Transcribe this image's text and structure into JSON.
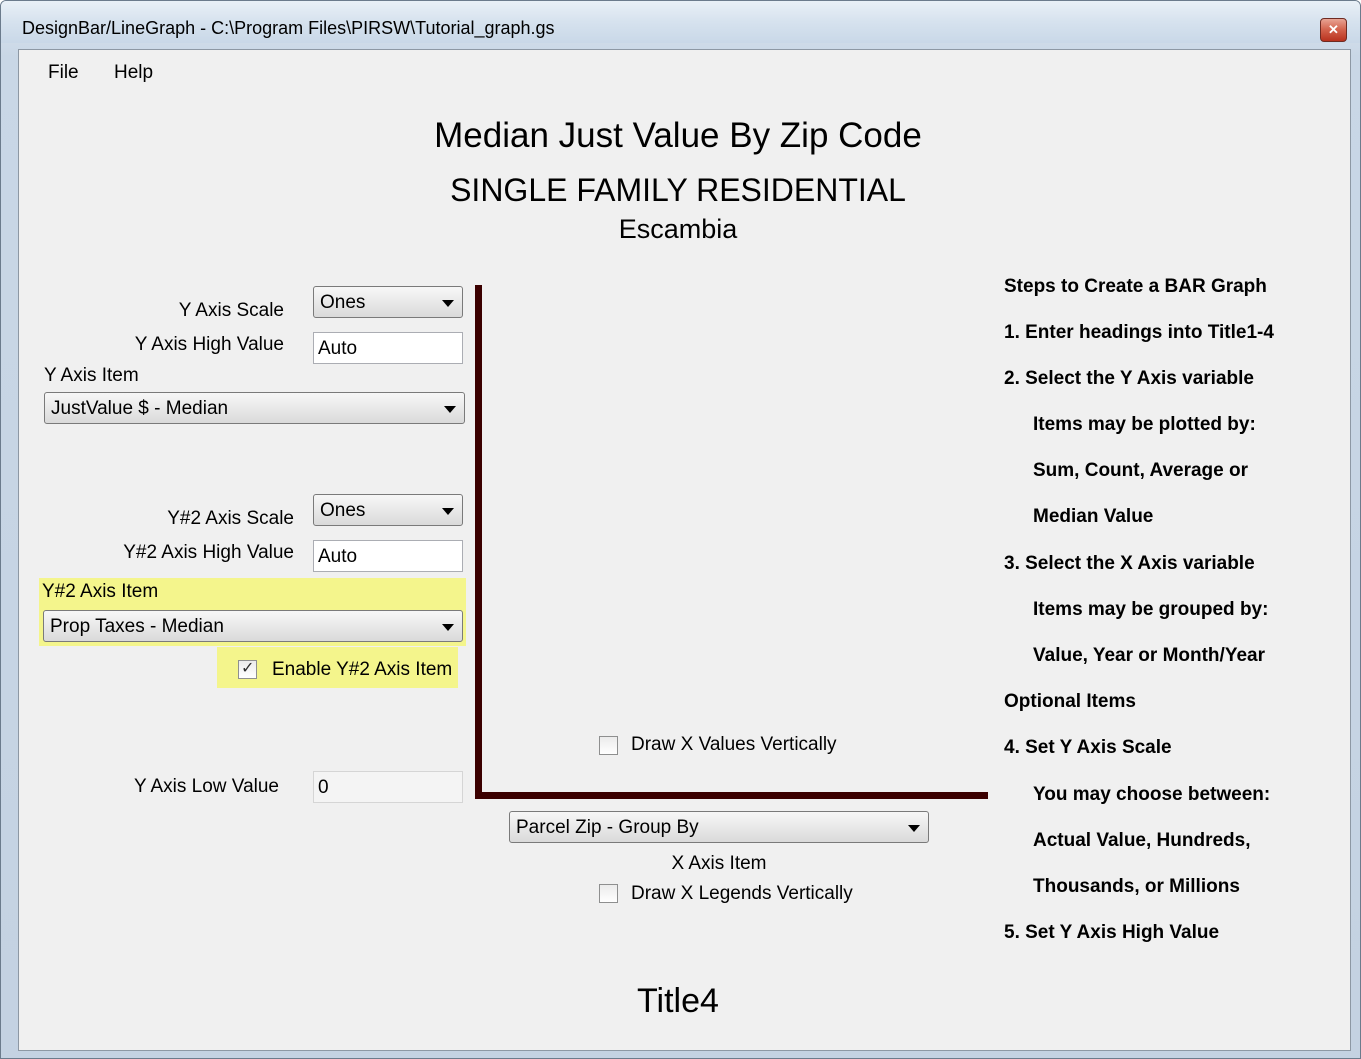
{
  "window": {
    "title": "DesignBar/LineGraph - C:\\Program Files\\PIRSW\\Tutorial_graph.gs",
    "close_glyph": "✕"
  },
  "menu": {
    "items": [
      "File",
      "Help"
    ]
  },
  "titles": {
    "title1": "Median Just Value By Zip Code",
    "title2": "SINGLE FAMILY RESIDENTIAL",
    "title3": "Escambia",
    "title4": "Title4"
  },
  "left_panel": {
    "y_axis_scale_label": "Y Axis Scale",
    "y_axis_scale_value": "Ones",
    "y_axis_high_label": "Y Axis High Value",
    "y_axis_high_value": "Auto",
    "y_axis_item_label": "Y Axis Item",
    "y_axis_item_value": "JustValue $ - Median",
    "y2_axis_scale_label": "Y#2 Axis Scale",
    "y2_axis_scale_value": "Ones",
    "y2_axis_high_label": "Y#2 Axis High Value",
    "y2_axis_high_value": "Auto",
    "y2_axis_item_label": "Y#2 Axis Item",
    "y2_axis_item_value": "Prop Taxes - Median",
    "enable_y2_label": "Enable Y#2 Axis Item",
    "enable_y2_checked": true,
    "y_axis_low_label": "Y Axis Low Value",
    "y_axis_low_value": "0"
  },
  "center": {
    "draw_x_values_label": "Draw X Values Vertically",
    "x_axis_item_value": "Parcel Zip - Group By",
    "x_axis_item_label": "X Axis Item",
    "draw_x_legends_label": "Draw X Legends Vertically"
  },
  "steps": [
    "Steps to Create a BAR Graph",
    "1.  Enter headings into Title1-4",
    "2.  Select the Y Axis variable",
    "Items may be plotted by:",
    "Sum, Count, Average or",
    "Median Value",
    "3.  Select the X Axis variable",
    "Items may be grouped by:",
    "Value, Year or Month/Year",
    "Optional Items",
    "4.  Set Y Axis Scale",
    "You may choose between:",
    "Actual Value, Hundreds,",
    "Thousands, or Millions",
    "5.  Set Y Axis High Value"
  ],
  "colors": {
    "axis": "#3b0000",
    "highlight": "#f4f58c"
  }
}
